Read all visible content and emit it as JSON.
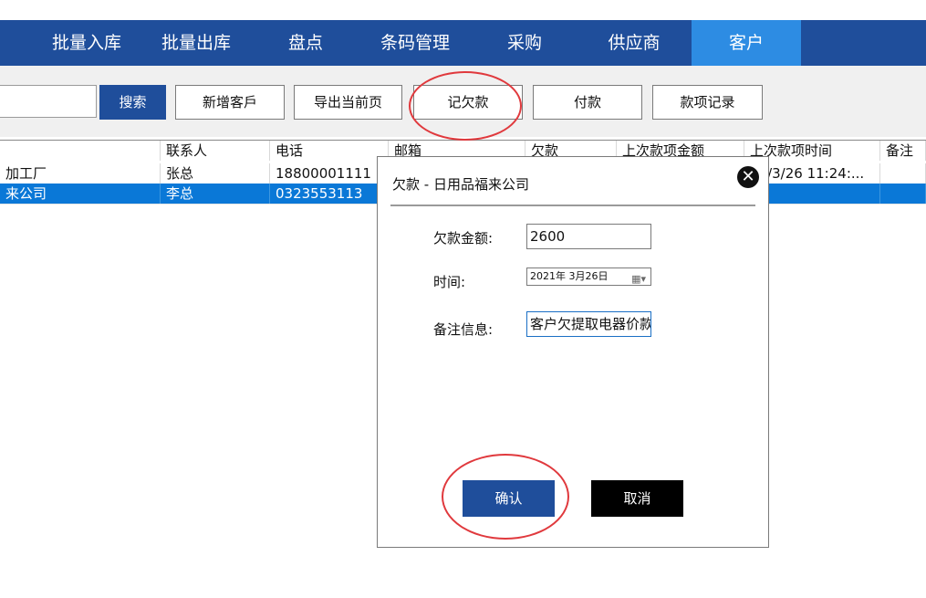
{
  "nav": {
    "items": [
      {
        "label": "批量入库"
      },
      {
        "label": "批量出库"
      },
      {
        "label": "盘点"
      },
      {
        "label": "条码管理"
      },
      {
        "label": "采购"
      },
      {
        "label": "供应商"
      },
      {
        "label": "客户",
        "active": true
      }
    ],
    "bar_color": "#1f4e9b",
    "active_color": "#2d8ce3"
  },
  "toolbar": {
    "search_value": "",
    "search_label": "搜索",
    "add_customer_label": "新增客戶",
    "export_label": "导出当前页",
    "record_debt_label": "记欠款",
    "payment_label": "付款",
    "history_label": "款项记录"
  },
  "table": {
    "columns": [
      "",
      "联系人",
      "电话",
      "邮箱",
      "欠款",
      "上次款项金额",
      "上次款项时间",
      "备注"
    ],
    "rows": [
      {
        "name": "加工厂",
        "contact": "张总",
        "phone": "18800001111",
        "email": "",
        "debt": "",
        "last_amount": "",
        "last_time": "21/3/26 11:24:...",
        "note": "",
        "selected": false
      },
      {
        "name": "来公司",
        "contact": "李总",
        "phone": "0323553113",
        "email": "",
        "debt": "",
        "last_amount": "",
        "last_time": "",
        "note": "",
        "selected": true
      }
    ]
  },
  "dialog": {
    "title": "欠款 - 日用品福来公司",
    "close_icon": "close-icon",
    "amount_label": "欠款金额:",
    "amount_value": "2600",
    "time_label": "时间:",
    "time_value": "2021年  3月26日",
    "note_label": "备注信息:",
    "note_value": "客户欠提取电器价款",
    "confirm_label": "确认",
    "cancel_label": "取消"
  },
  "annotation_color": "#e0393d"
}
